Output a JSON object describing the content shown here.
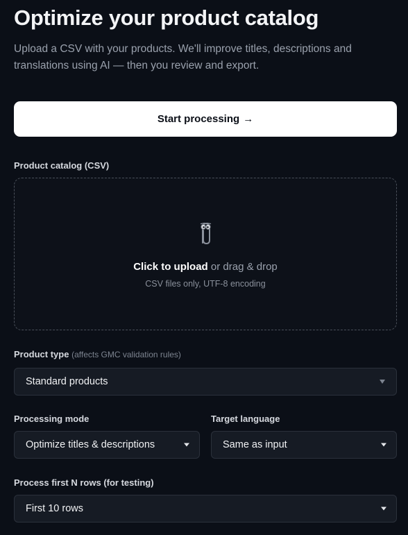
{
  "header": {
    "title": "Optimize your product catalog",
    "subtitle": "Upload a CSV with your products. We'll improve titles, descriptions and translations using AI — then you review and export."
  },
  "start_button": {
    "label": "Start processing",
    "arrow": "→"
  },
  "upload": {
    "label": "Product catalog (CSV)",
    "icon": "paperclip-icon",
    "action_text": "Click to upload",
    "alt_text": "or drag & drop",
    "note": "CSV files only, UTF-8 encoding"
  },
  "product_type": {
    "label": "Product type",
    "hint": "(affects GMC validation rules)",
    "value": "Standard products"
  },
  "processing_mode": {
    "label": "Processing mode",
    "value": "Optimize titles & descriptions"
  },
  "target_language": {
    "label": "Target language",
    "value": "Same as input"
  },
  "row_limit": {
    "label": "Process first N rows (for testing)",
    "value": "First 10 rows"
  },
  "colors": {
    "background": "#0b0f17",
    "button_bg": "#ffffff",
    "field_bg": "#161b24",
    "field_border": "#2b313b"
  }
}
